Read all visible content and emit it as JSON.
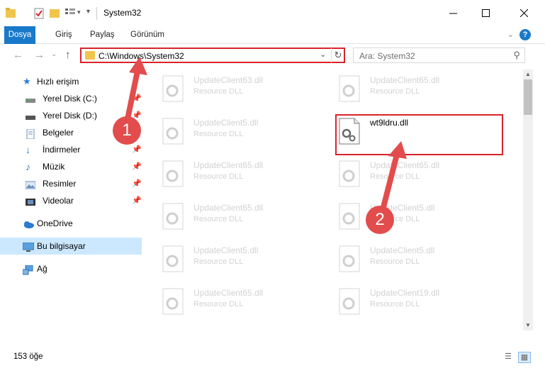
{
  "window": {
    "title": "System32",
    "buttons": [
      "minimize",
      "maximize",
      "close"
    ]
  },
  "ribbon": {
    "tabs": [
      "Dosya",
      "Giriş",
      "Paylaş",
      "Görünüm"
    ]
  },
  "address": {
    "path": "C:\\Windows\\System32"
  },
  "search": {
    "placeholder": "Ara: System32"
  },
  "sidebar": {
    "quick_access": "Hızlı erişim",
    "items": [
      {
        "label": "Yerel Disk (C:)",
        "icon": "drive-icon",
        "pinned": true
      },
      {
        "label": "Yerel Disk (D:)",
        "icon": "drive-icon",
        "pinned": true
      },
      {
        "label": "Belgeler",
        "icon": "documents-icon",
        "pinned": true
      },
      {
        "label": "İndirmeler",
        "icon": "downloads-icon",
        "pinned": true
      },
      {
        "label": "Müzik",
        "icon": "music-icon",
        "pinned": true
      },
      {
        "label": "Resimler",
        "icon": "pictures-icon",
        "pinned": true
      },
      {
        "label": "Videolar",
        "icon": "videos-icon",
        "pinned": true
      }
    ],
    "onedrive": "OneDrive",
    "this_pc": "Bu bilgisayar",
    "network": "Ağ"
  },
  "files": {
    "left_column": [
      {
        "name": "UpdateClient63.dll",
        "type": "Resource DLL"
      },
      {
        "name": "UpdateClient5.dll",
        "type": "Resource DLL"
      },
      {
        "name": "UpdateClient65.dll",
        "type": "Resource DLL"
      },
      {
        "name": "UpdateClient65.dll",
        "type": "Resource DLL"
      },
      {
        "name": "UpdateClient5.dll",
        "type": "Resource DLL"
      },
      {
        "name": "UpdateClient65.dll",
        "type": "Resource DLL"
      }
    ],
    "right_column": [
      {
        "name": "UpdateClient65.dll",
        "type": "Resource DLL"
      },
      {
        "name": "wt9ldru.dll",
        "type": ""
      },
      {
        "name": "UpdateClient65.dll",
        "type": "Resource DLL"
      },
      {
        "name": "UpdateClient5.dll",
        "type": "Resource DLL"
      },
      {
        "name": "UpdateClient5.dll",
        "type": "Resource DLL"
      },
      {
        "name": "UpdateClient19.dll",
        "type": "Resource DLL"
      }
    ]
  },
  "annotations": {
    "step1": "1",
    "step2": "2"
  },
  "status": {
    "count": "153 öğe"
  },
  "colors": {
    "accent": "#1979ca",
    "annotation": "#d9232a",
    "selected": "#cce8ff"
  }
}
